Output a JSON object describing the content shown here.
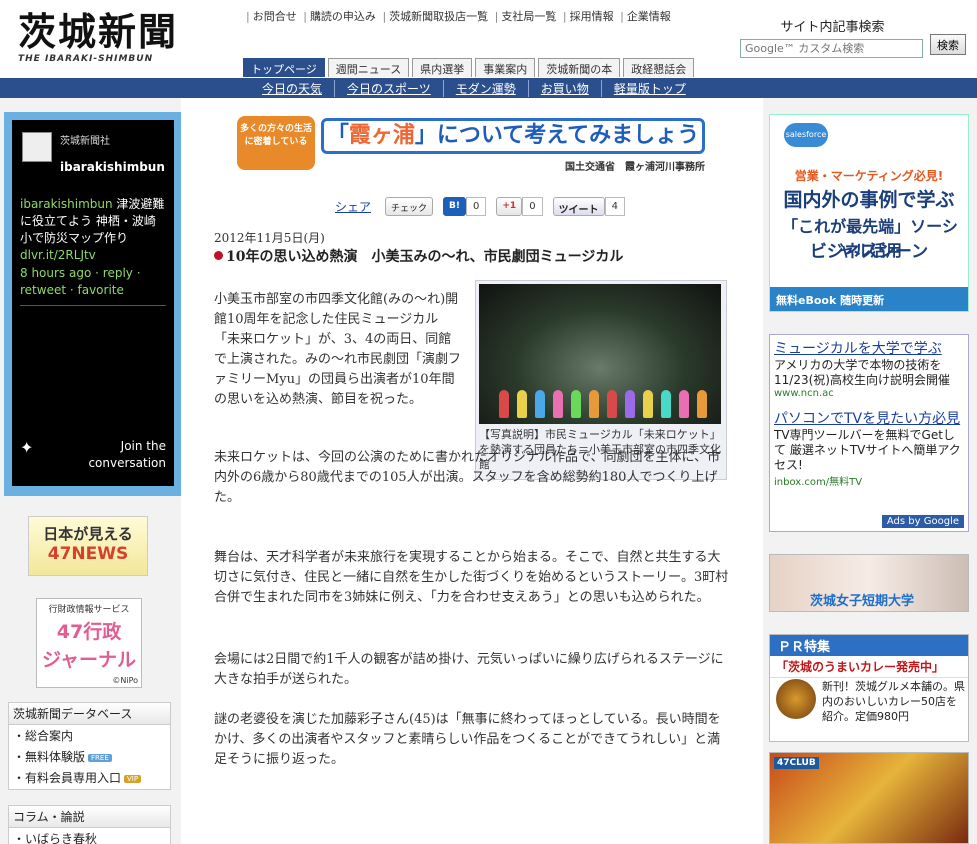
{
  "header": {
    "logo_text": "茨城新聞",
    "logo_sub": "THE IBARAKI-SHIMBUN",
    "top_links": [
      "お問合せ",
      "購読の申込み",
      "茨城新聞取扱店一覧",
      "支社局一覧",
      "採用情報",
      "企業情報"
    ],
    "tabs": [
      "トップページ",
      "週間ニュース",
      "県内選挙",
      "事業案内",
      "茨城新聞の本",
      "政経懇話会"
    ],
    "search_label": "サイト内記事検索",
    "search_placeholder": "Google™ カスタム検索",
    "search_button": "検索"
  },
  "navbar": [
    "今日の天気",
    "今日のスポーツ",
    "モダン運勢",
    "お買い物",
    "軽量版トップ"
  ],
  "left": {
    "twitter": {
      "account_name": "茨城新聞社",
      "handle": "ibarakishimbun",
      "tweet_user": "ibarakishimbun",
      "tweet_text": "津波避難に役立てよう 神栖・波崎小で防災マップ作り",
      "tweet_link": "dlvr.it/2RLJtv",
      "time": "8 hours ago",
      "reply": "reply",
      "retweet": "retweet",
      "favorite": "favorite",
      "join1": "Join the",
      "join2": "conversation"
    },
    "ad_47news": {
      "line1": "日本が見える",
      "line2": "47NEWS"
    },
    "ad_47gyosei": {
      "line1": "行財政情報サービス",
      "line2": "47行政",
      "line3": "ジャーナル",
      "credit": "©NiPo"
    },
    "database": {
      "title": "茨城新聞データベース",
      "items": [
        "・総合案内",
        "・無料体験版",
        "・有料会員専用入口"
      ],
      "badge_free": "FREE",
      "badge_vip": "VIP"
    },
    "column": {
      "title": "コラム・論説",
      "items": [
        "・いばらき春秋"
      ]
    }
  },
  "main": {
    "banner": {
      "badge": "多くの方々の生活に密着している",
      "title_pre": "「",
      "title_main": "霞ヶ浦",
      "title_post": "」について考えてみましょう",
      "sub": "国土交通省　霞ヶ浦河川事務所"
    },
    "share": {
      "share_label": "シェア",
      "check_label": "チェック",
      "hatena_label": "B!",
      "hatena_count": "0",
      "gplus_label": "+1",
      "gplus_count": "0",
      "tweet_label": "ツイート",
      "tweet_count": "4"
    },
    "date": "2012年11月5日(月)",
    "headline": "10年の思い込め熱演　小美玉みの～れ、市民劇団ミュージカル",
    "photo_caption": "【写真説明】市民ミュージカル「未来ロケット」を熱演する団員たち＝小美玉市部室の市四季文化館",
    "paragraphs": [
      "小美玉市部室の市四季文化館(みの～れ)開館10周年を記念した住民ミュージカル「未来ロケット」が、3、4の両日、同館で上演された。みの～れ市民劇団「演劇ファミリーMyu」の団員ら出演者が10年間の思いを込め熱演、節目を祝った。",
      "未来ロケットは、今回の公演のために書かれたオリジナル作品で、同劇団を主体に、市内外の6歳から80歳代までの105人が出演。スタッフを含め総勢約180人でつくり上げた。",
      "舞台は、天才科学者が未来旅行を実現することから始まる。そこで、自然と共生する大切さに気付き、住民と一緒に自然を生かした街づくりを始めるというストーリー。3町村合併で生まれた同市を3姉妹に例え、「力を合わせ支えあう」との思いも込められた。",
      "会場には2日間で約1千人の観客が詰め掛け、元気いっぱいに繰り広げられるステージに大きな拍手が送られた。",
      "謎の老婆役を演じた加藤彩子さん(45)は「無事に終わってほっとしている。長い時間をかけ、多くの出演者やスタッフと素晴らしい作品をつくることができてうれしい」と満足そうに振り返った。"
    ]
  },
  "right": {
    "ad_salesforce": {
      "logo": "salesforce",
      "l1": "営業・マーケティング必見!",
      "l2": "国内外の事例で学ぶ",
      "l3": "「これが最先端」ソーシャル活用",
      "l4": "ビジネスシーン",
      "foot": "無料eBook 随時更新"
    },
    "google_ads": [
      {
        "title": "ミュージカルを大学で学ぶ",
        "desc": "アメリカの大学で本物の技術を 11/23(祝)高校生向け説明会開催",
        "url": "www.ncn.ac"
      },
      {
        "title": "パソコンでTVを見たい方必見",
        "desc": "TV専門ツールバーを無料でGetして 厳選ネットTVサイトへ簡単アクセス!",
        "url": "inbox.com/無料TV"
      }
    ],
    "ads_by": "Ads by Google",
    "ad_jc": "茨城女子短期大学",
    "pr": {
      "title": "ＰＲ特集",
      "sub": "「茨城のうまいカレー発売中」",
      "text": "新刊！茨城グルメ本舗の。県内のおいしいカレー50店を紹介。定価980円"
    },
    "ad_47club": "47CLUB"
  },
  "colors": {
    "brand_blue": "#2b4e8c",
    "twitter_frame": "#6ab1e2",
    "accent_red": "#c0102a"
  }
}
